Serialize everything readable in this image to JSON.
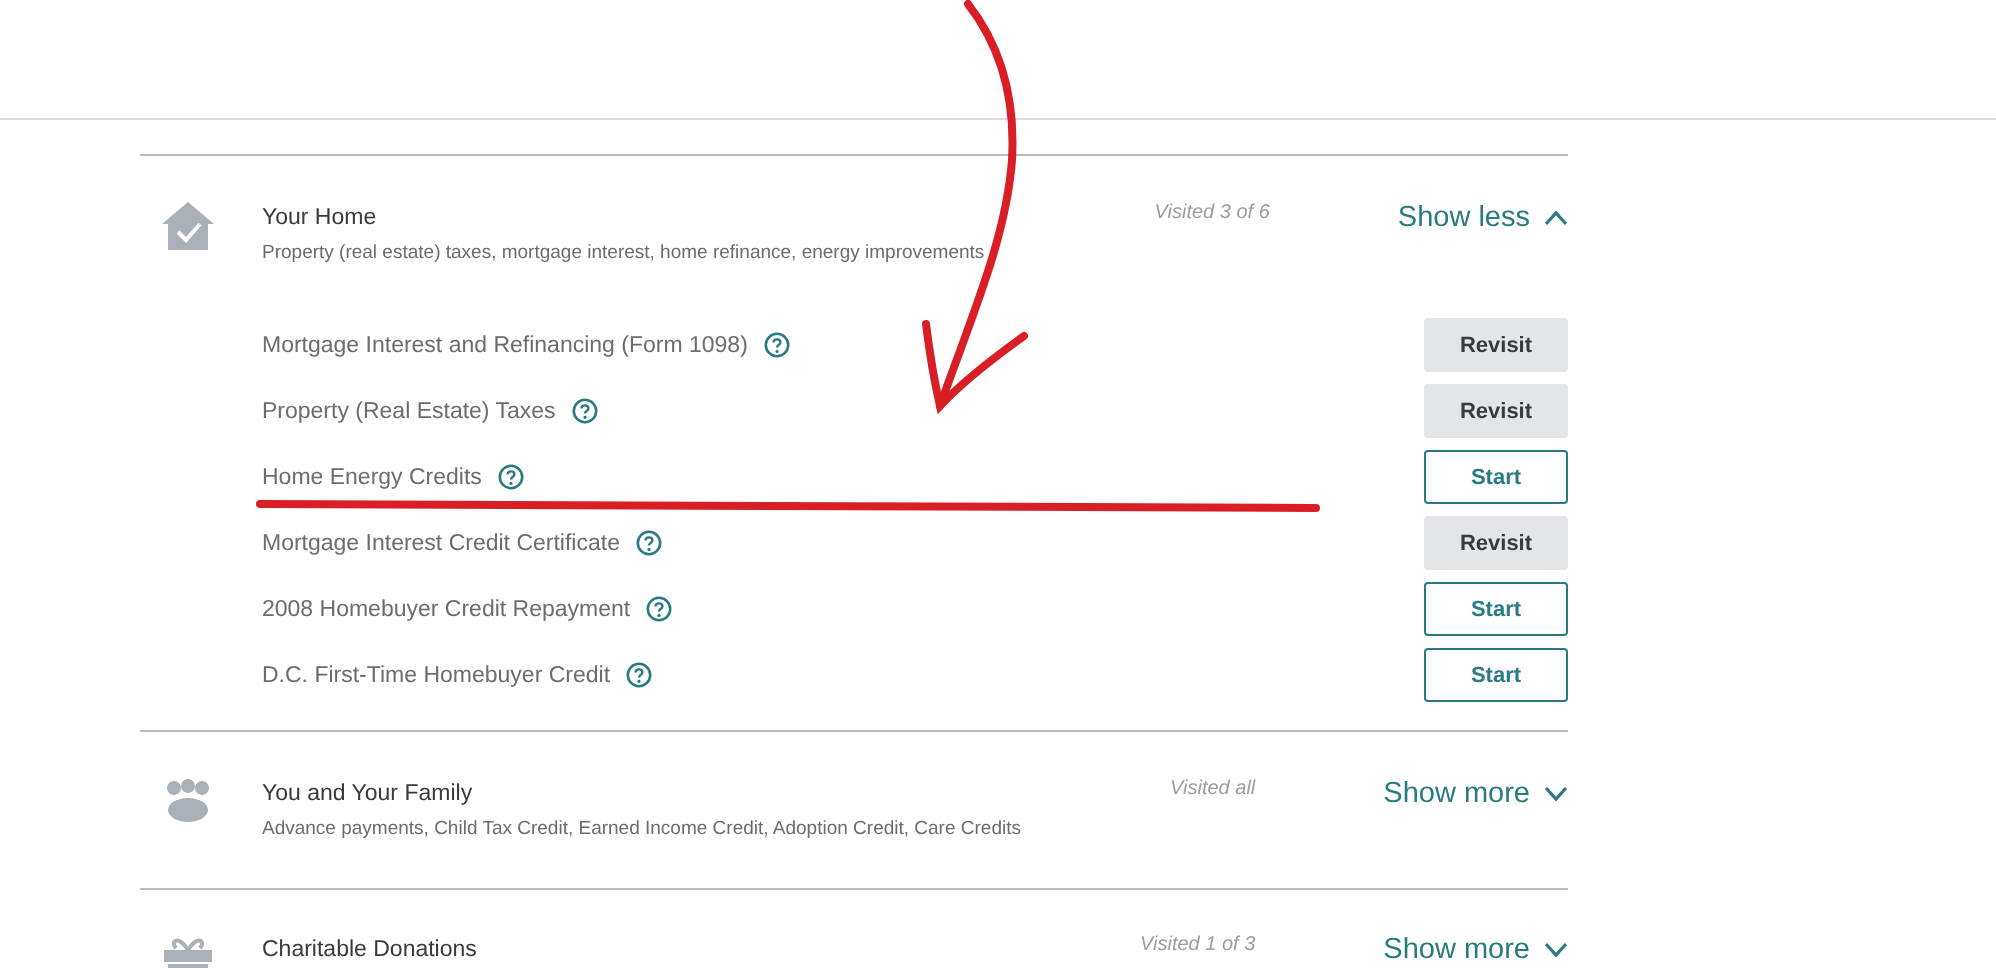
{
  "sections": [
    {
      "kind": "house",
      "title": "Your Home",
      "subtitle": "Property (real estate) taxes, mortgage interest, home refinance, energy improvements",
      "visited": "Visited 3 of 6",
      "toggle": "Show less",
      "expanded": true,
      "items": [
        {
          "label": "Mortgage Interest and Refinancing (Form 1098)",
          "action": {
            "kind": "revisit",
            "label": "Revisit"
          }
        },
        {
          "label": "Property (Real Estate) Taxes",
          "action": {
            "kind": "revisit",
            "label": "Revisit"
          }
        },
        {
          "label": "Home Energy Credits",
          "action": {
            "kind": "start",
            "label": "Start"
          }
        },
        {
          "label": "Mortgage Interest Credit Certificate",
          "action": {
            "kind": "revisit",
            "label": "Revisit"
          }
        },
        {
          "label": "2008 Homebuyer Credit Repayment",
          "action": {
            "kind": "start",
            "label": "Start"
          }
        },
        {
          "label": "D.C. First-Time Homebuyer Credit",
          "action": {
            "kind": "start",
            "label": "Start"
          }
        }
      ]
    },
    {
      "kind": "family",
      "title": "You and Your Family",
      "subtitle": "Advance payments, Child Tax Credit, Earned Income Credit, Adoption Credit, Care Credits",
      "visited": "Visited all",
      "toggle": "Show more",
      "expanded": false
    },
    {
      "kind": "gift",
      "title": "Charitable Donations",
      "visited": "Visited 1 of 3",
      "toggle": "Show more",
      "expanded": false
    }
  ]
}
